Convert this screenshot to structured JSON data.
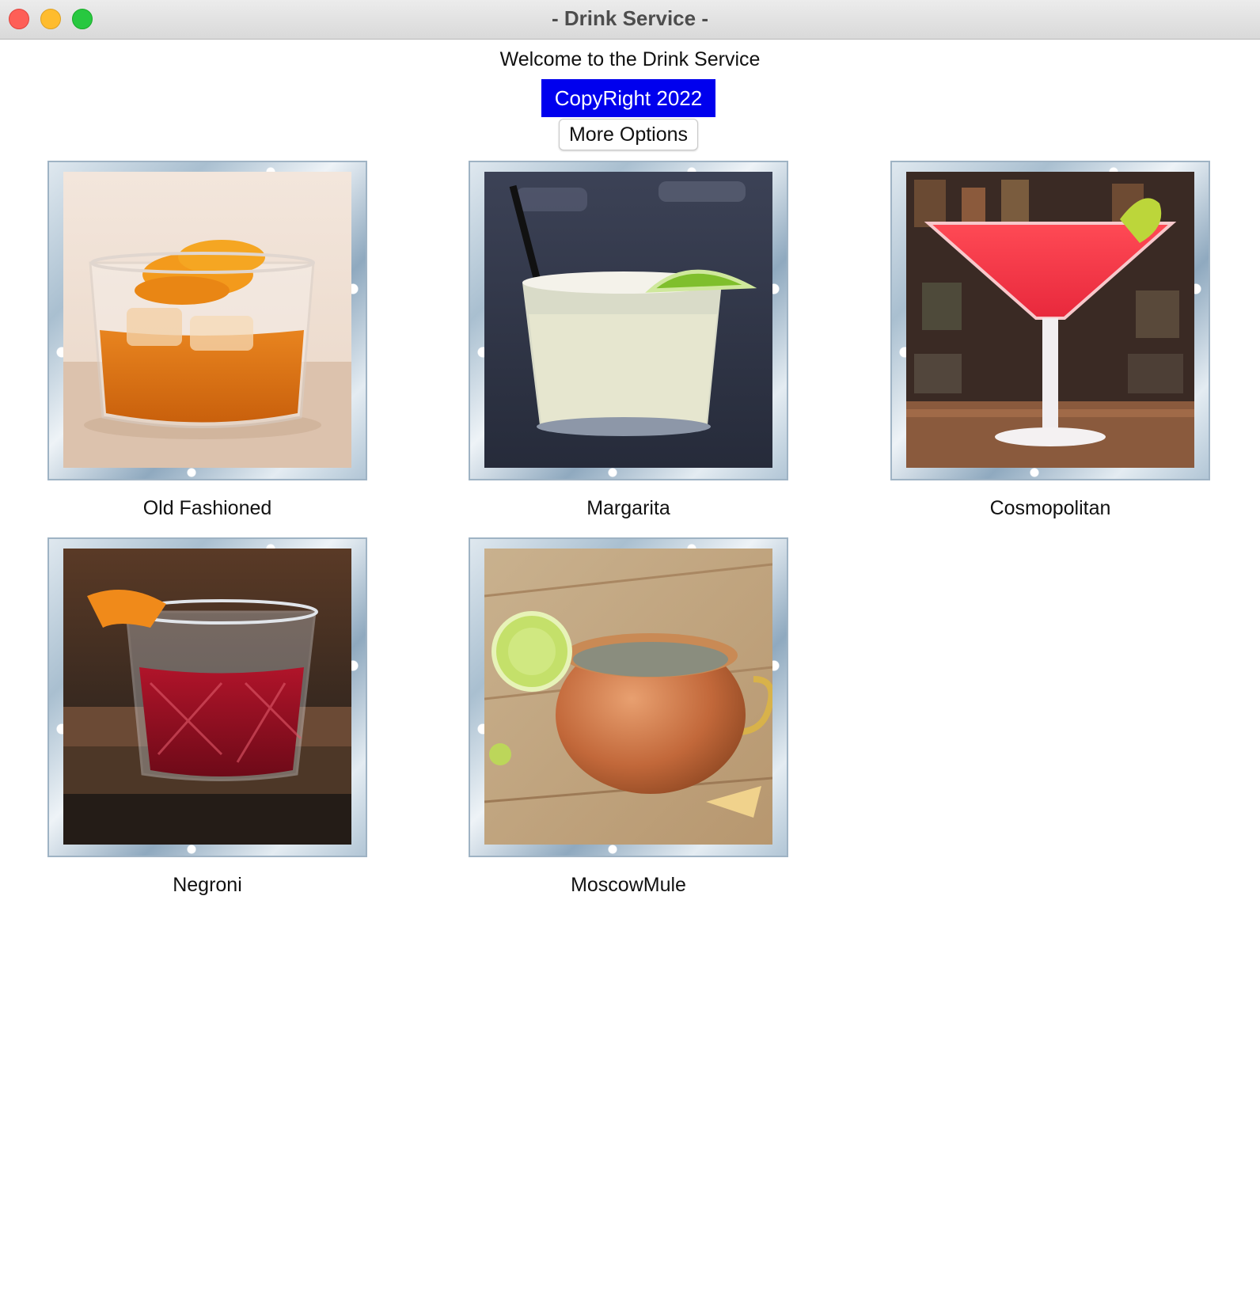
{
  "window": {
    "title": "- Drink Service -"
  },
  "header": {
    "welcome": "Welcome to the Drink Service",
    "copyright": "CopyRight 2022",
    "more_options": "More Options"
  },
  "drinks": [
    {
      "name": "Old Fashioned"
    },
    {
      "name": "Margarita"
    },
    {
      "name": "Cosmopolitan"
    },
    {
      "name": "Negroni"
    },
    {
      "name": "MoscowMule"
    }
  ],
  "colors": {
    "copyright_bg": "#0000ee",
    "copyright_text": "#ffffff",
    "close": "#fe5f57",
    "minimize": "#febc2e",
    "zoom": "#28c840"
  }
}
